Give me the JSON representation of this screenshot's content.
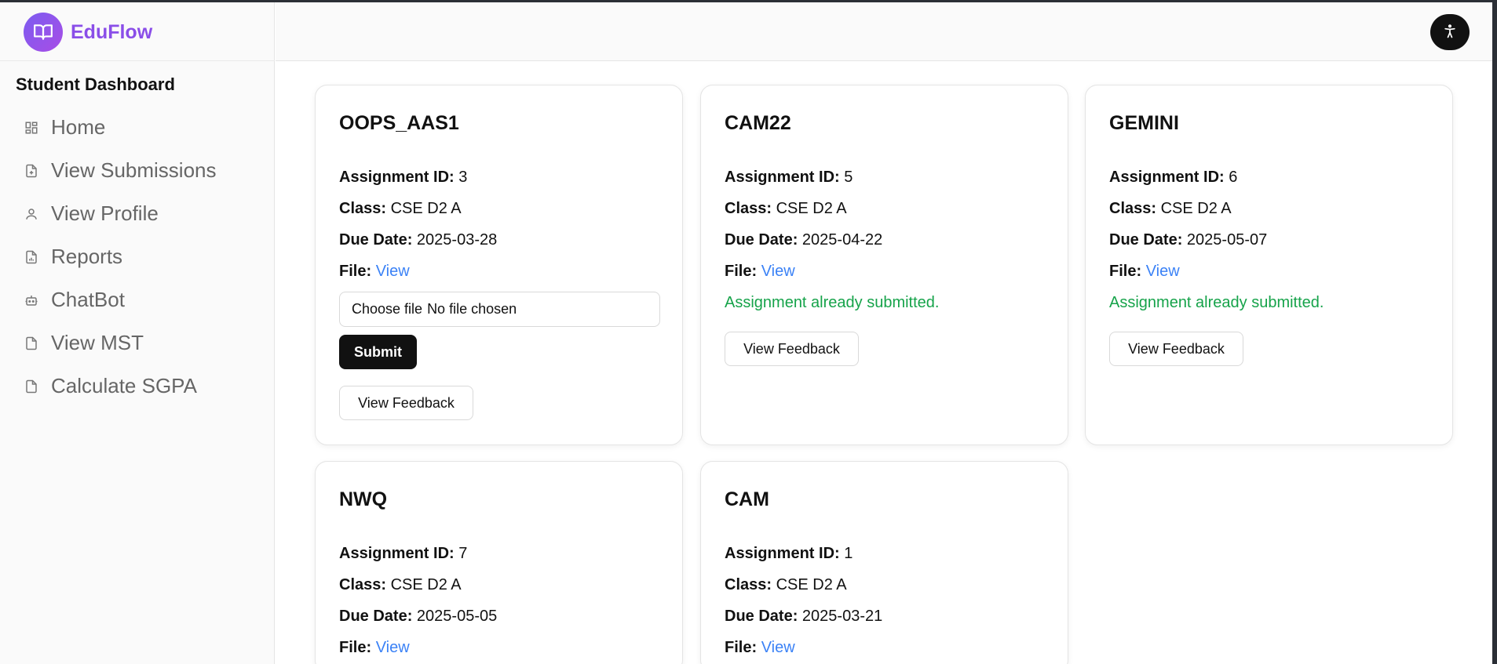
{
  "brand": {
    "name": "EduFlow"
  },
  "sidebar": {
    "title": "Student Dashboard",
    "items": [
      {
        "label": "Home",
        "icon": "dashboard-grid-icon"
      },
      {
        "label": "View Submissions",
        "icon": "file-plus-icon"
      },
      {
        "label": "View Profile",
        "icon": "user-icon"
      },
      {
        "label": "Reports",
        "icon": "file-chart-icon"
      },
      {
        "label": "ChatBot",
        "icon": "bot-icon"
      },
      {
        "label": "View MST",
        "icon": "file-icon"
      },
      {
        "label": "Calculate SGPA",
        "icon": "file-icon"
      }
    ]
  },
  "labels": {
    "assignment_id": "Assignment ID:",
    "class": "Class:",
    "due_date": "Due Date:",
    "file": "File:",
    "file_link": "View",
    "submitted": "Assignment already submitted.",
    "choose_file": "Choose file",
    "no_file": "No file chosen",
    "submit": "Submit",
    "view_feedback": "View Feedback"
  },
  "assignments": [
    {
      "title": "OOPS_AAS1",
      "id": "3",
      "class": "CSE D2 A",
      "due_date": "2025-03-28",
      "submitted": false
    },
    {
      "title": "CAM22",
      "id": "5",
      "class": "CSE D2 A",
      "due_date": "2025-04-22",
      "submitted": true
    },
    {
      "title": "GEMINI",
      "id": "6",
      "class": "CSE D2 A",
      "due_date": "2025-05-07",
      "submitted": true
    },
    {
      "title": "NWQ",
      "id": "7",
      "class": "CSE D2 A",
      "due_date": "2025-05-05",
      "submitted": null
    },
    {
      "title": "CAM",
      "id": "1",
      "class": "CSE D2 A",
      "due_date": "2025-03-21",
      "submitted": null
    }
  ],
  "colors": {
    "accent": "#8a4ee8",
    "link": "#3b82f6",
    "success": "#16a34a",
    "primary_button": "#111111"
  }
}
